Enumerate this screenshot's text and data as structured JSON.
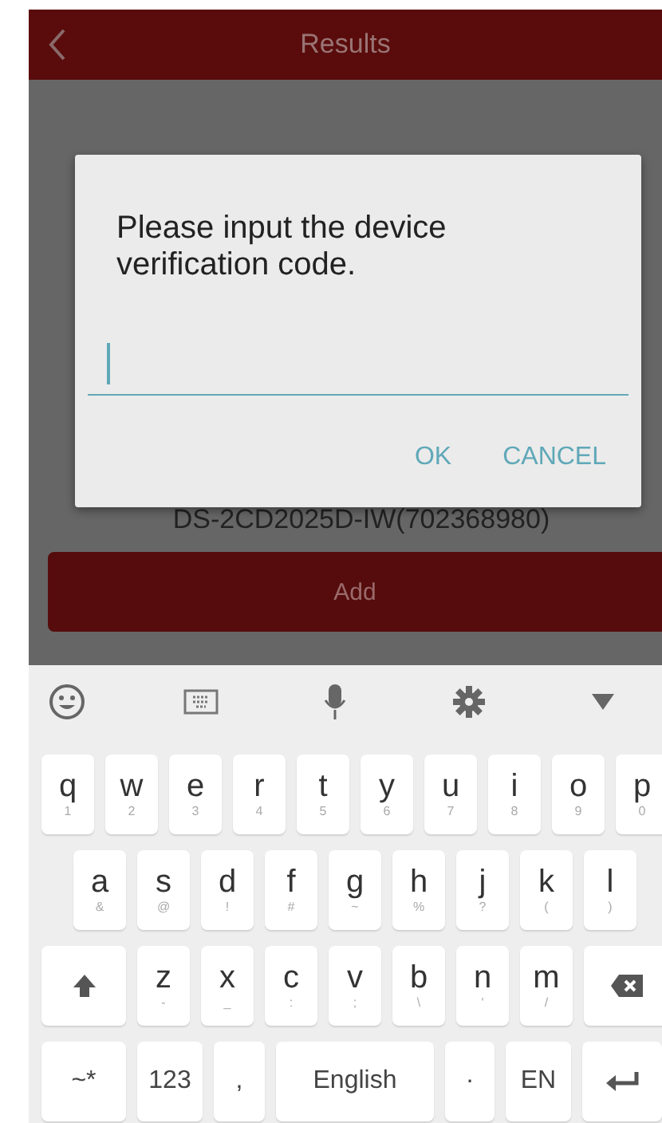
{
  "header": {
    "title": "Results"
  },
  "device": {
    "name": "DS-2CD2025D-IW(702368980)"
  },
  "add_button": {
    "label": "Add"
  },
  "dialog": {
    "message": "Please input the device verification code.",
    "buttons": [
      "OK",
      "CANCEL"
    ]
  },
  "keyboard": {
    "rows": [
      {
        "keys": [
          {
            "kind": "letter",
            "label": "q",
            "hint": "1"
          },
          {
            "kind": "letter",
            "label": "w",
            "hint": "2"
          },
          {
            "kind": "letter",
            "label": "e",
            "hint": "3"
          },
          {
            "kind": "letter",
            "label": "r",
            "hint": "4"
          },
          {
            "kind": "letter",
            "label": "t",
            "hint": "5"
          },
          {
            "kind": "letter",
            "label": "y",
            "hint": "6"
          },
          {
            "kind": "letter",
            "label": "u",
            "hint": "7"
          },
          {
            "kind": "letter",
            "label": "i",
            "hint": "8"
          },
          {
            "kind": "letter",
            "label": "o",
            "hint": "9"
          },
          {
            "kind": "letter",
            "label": "p",
            "hint": "0"
          }
        ]
      },
      {
        "keys": [
          {
            "kind": "letter",
            "label": "a",
            "hint": "&"
          },
          {
            "kind": "letter",
            "label": "s",
            "hint": "@"
          },
          {
            "kind": "letter",
            "label": "d",
            "hint": "!"
          },
          {
            "kind": "letter",
            "label": "f",
            "hint": "#"
          },
          {
            "kind": "letter",
            "label": "g",
            "hint": "~"
          },
          {
            "kind": "letter",
            "label": "h",
            "hint": "%"
          },
          {
            "kind": "letter",
            "label": "j",
            "hint": "?"
          },
          {
            "kind": "letter",
            "label": "k",
            "hint": "("
          },
          {
            "kind": "letter",
            "label": "l",
            "hint": ")"
          }
        ]
      },
      {
        "keys": [
          {
            "kind": "shift"
          },
          {
            "kind": "letter",
            "label": "z",
            "hint": "-"
          },
          {
            "kind": "letter",
            "label": "x",
            "hint": "_"
          },
          {
            "kind": "letter",
            "label": "c",
            "hint": ":"
          },
          {
            "kind": "letter",
            "label": "v",
            "hint": ";"
          },
          {
            "kind": "letter",
            "label": "b",
            "hint": "\\"
          },
          {
            "kind": "letter",
            "label": "n",
            "hint": "'"
          },
          {
            "kind": "letter",
            "label": "m",
            "hint": "/"
          },
          {
            "kind": "backspace"
          }
        ]
      },
      {
        "keys": [
          {
            "kind": "label",
            "label": "~*"
          },
          {
            "kind": "label",
            "label": "123"
          },
          {
            "kind": "label",
            "label": ","
          },
          {
            "kind": "label",
            "label": "English"
          },
          {
            "kind": "label",
            "label": "·"
          },
          {
            "kind": "label",
            "label": "EN"
          },
          {
            "kind": "enter"
          }
        ]
      }
    ]
  }
}
